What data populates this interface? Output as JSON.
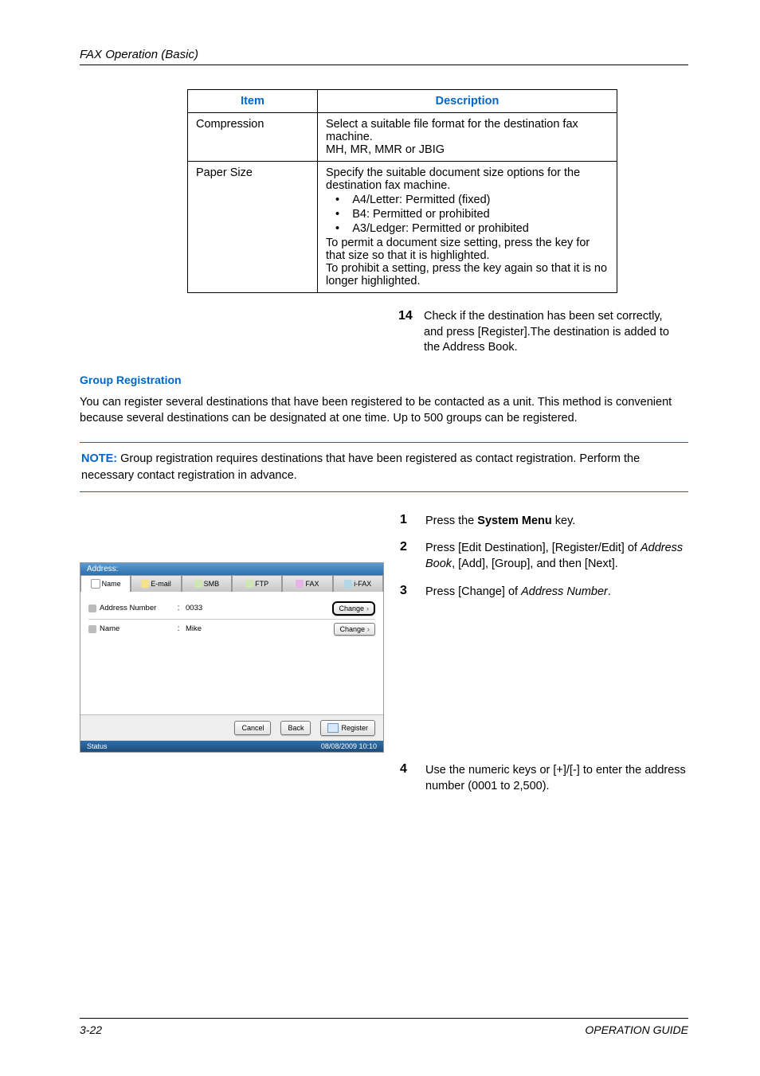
{
  "header": {
    "title": "FAX Operation (Basic)"
  },
  "table": {
    "headers": {
      "item": "Item",
      "desc": "Description"
    },
    "rows": [
      {
        "item": "Compression",
        "desc_line1": "Select a suitable file format for the destination fax machine.",
        "desc_line2": "MH, MR, MMR or JBIG"
      },
      {
        "item": "Paper Size",
        "intro": "Specify the suitable document size options for the destination fax machine.",
        "b1": "A4/Letter: Permitted (fixed)",
        "b2": "B4: Permitted or prohibited",
        "b3": "A3/Ledger: Permitted or prohibited",
        "tail": "To permit a document size setting, press the key for that size so that it is highlighted.\nTo prohibit a setting, press the key again so that it is no longer highlighted."
      }
    ]
  },
  "step14": {
    "num": "14",
    "text": "Check if the destination has been set correctly, and press [Register].The destination is added to the Address Book."
  },
  "group_reg": {
    "heading": "Group Registration",
    "para": "You can register several destinations that have been registered to be contacted as a unit. This method is convenient because several destinations can be designated at one time. Up to 500 groups can be registered."
  },
  "note": {
    "label": "NOTE:",
    "text": " Group registration requires destinations that have been registered as contact registration. Perform the necessary contact registration in advance."
  },
  "steps": {
    "s1": {
      "num": "1",
      "pre": "Press the ",
      "bold": "System Menu",
      "post": " key."
    },
    "s2": {
      "num": "2",
      "pre": "Press [Edit Destination], [Register/Edit] of ",
      "it1": "Address Book",
      "mid": ", [Add], [Group], and then [Next]."
    },
    "s3": {
      "num": "3",
      "pre": "Press [Change] of ",
      "it": "Address Number",
      "post": "."
    },
    "s4": {
      "num": "4",
      "text": "Use the numeric keys or [+]/[-] to enter the address number (0001 to 2,500)."
    }
  },
  "ui": {
    "titlebar": "Address:",
    "tabs": {
      "name": "Name",
      "email": "E-mail",
      "smb": "SMB",
      "ftp": "FTP",
      "fax": "FAX",
      "ifax": "i-FAX"
    },
    "rows": [
      {
        "label": "Address Number",
        "value": "0033",
        "btn": "Change"
      },
      {
        "label": "Name",
        "value": "Mike",
        "btn": "Change"
      }
    ],
    "buttons": {
      "cancel": "Cancel",
      "back": "Back",
      "register": "Register"
    },
    "status": {
      "label": "Status",
      "time": "08/08/2009   10:10"
    }
  },
  "footer": {
    "page": "3-22",
    "guide": "OPERATION GUIDE"
  }
}
